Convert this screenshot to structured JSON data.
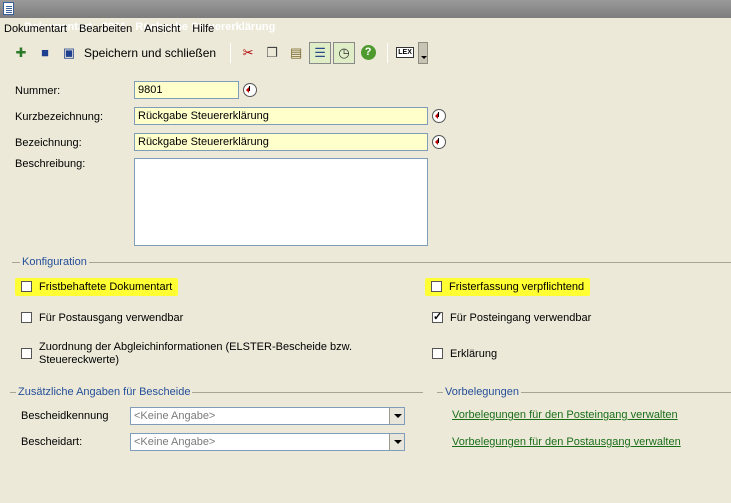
{
  "window": {
    "title": "Dokumentart - 9801   Rückgabe Steuererklärung"
  },
  "menu": [
    "Dokumentart",
    "Bearbeiten",
    "Ansicht",
    "Hilfe"
  ],
  "toolbar": {
    "save_close_label": "Speichern und schließen",
    "icons": [
      "new-icon",
      "save-icon",
      "save-close-icon",
      "cut-icon",
      "copy-icon",
      "paste-icon",
      "list-icon",
      "history-icon",
      "help-icon",
      "lex-icon"
    ]
  },
  "form": {
    "nummer_label": "Nummer:",
    "nummer_value": "9801",
    "kurz_label": "Kurzbezeichnung:",
    "kurz_value": "Rückgabe Steuererklärung",
    "bez_label": "Bezeichnung:",
    "bez_value": "Rückgabe Steuererklärung",
    "beschreibung_label": "Beschreibung:",
    "beschreibung_value": ""
  },
  "konfiguration": {
    "title": "Konfiguration",
    "fristbehaftet": {
      "label": "Fristbehaftete Dokumentart",
      "checked": false
    },
    "fristerfassung": {
      "label": "Fristerfassung verpflichtend",
      "checked": false
    },
    "postausgang": {
      "label": "Für Postausgang verwendbar",
      "checked": false
    },
    "posteingang": {
      "label": "Für Posteingang verwendbar",
      "checked": true
    },
    "zuordnung": {
      "label_line1": "Zuordnung der Abgleichinformationen (ELSTER-Bescheide bzw.",
      "label_line2": "Steuereckwerte)",
      "checked": false
    },
    "erklaerung": {
      "label": "Erklärung",
      "checked": false
    },
    "highlight_color": "#ffff33"
  },
  "bescheide": {
    "title": "Zusätzliche Angaben für Bescheide",
    "kennung_label": "Bescheidkennung",
    "kennung_value": "<Keine Angabe>",
    "art_label": "Bescheidart:",
    "art_value": "<Keine Angabe>"
  },
  "vorbelegungen": {
    "title": "Vorbelegungen",
    "link_posteingang": "Vorbelegungen für den Posteingang verwalten",
    "link_postausgang": "Vorbelegungen für den Postausgang verwalten"
  }
}
